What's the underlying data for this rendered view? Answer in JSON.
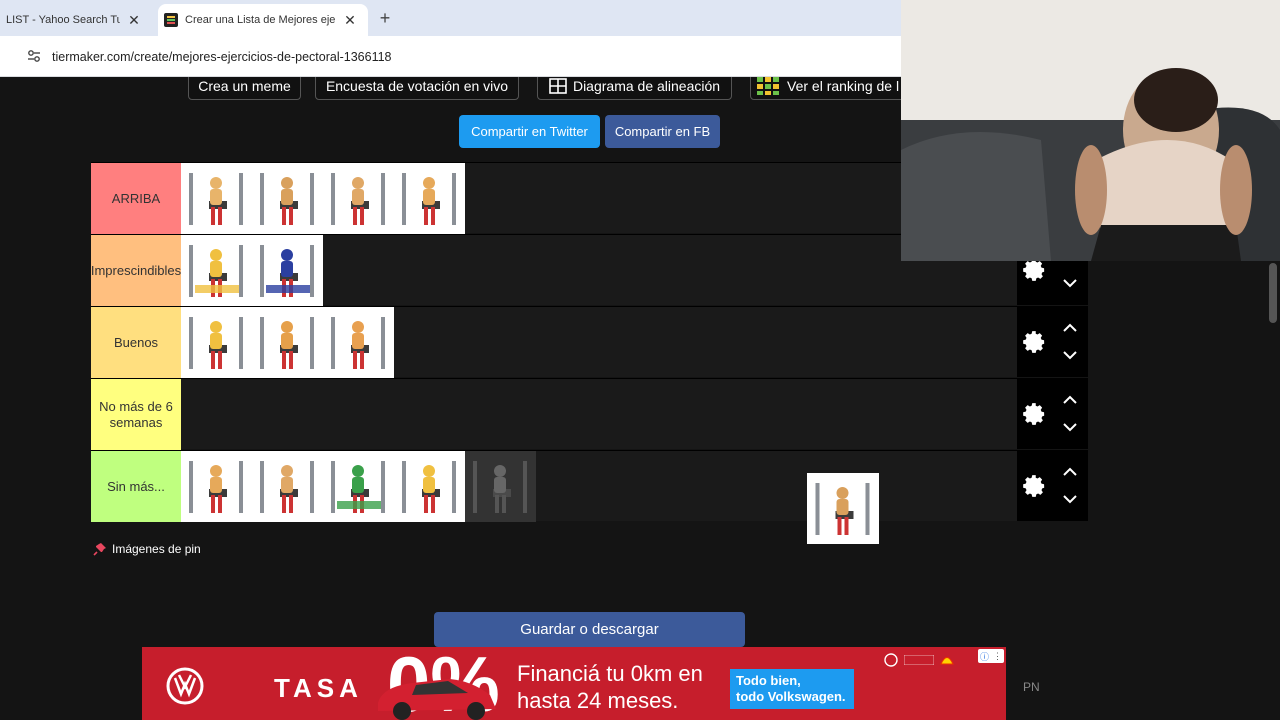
{
  "browser": {
    "tabs": [
      {
        "title": "LIST - Yahoo Search Tus re"
      },
      {
        "title": "Crear una Lista de Mejores ejerc"
      }
    ],
    "url": "tiermaker.com/create/mejores-ejercicios-de-pectoral-1366118"
  },
  "top_buttons": [
    "Crea un meme",
    "Encuesta de votación en vivo",
    "Diagrama de alineación",
    "Ver el ranking de l"
  ],
  "share": {
    "twitter": "Compartir en Twitter",
    "fb": "Compartir en FB",
    "twitter_color": "#1d9bf0",
    "fb_color": "#3c5a9a"
  },
  "tiers": [
    {
      "label": "ARRIBA",
      "color": "#ff7f7f",
      "item_count": 4
    },
    {
      "label": "Imprescindibles",
      "color": "#ffbf7f",
      "item_count": 2
    },
    {
      "label": "Buenos",
      "color": "#ffdf7f",
      "item_count": 3
    },
    {
      "label": "No más de 6 semanas",
      "color": "#ffff7f",
      "item_count": 0
    },
    {
      "label": "Sin más...",
      "color": "#bfff7f",
      "item_count": 5
    }
  ],
  "pin_label": "Imágenes de pin",
  "save_label": "Guardar o descargar",
  "ad": {
    "brand": "VW",
    "tasa": "TASA",
    "percent": "0%",
    "line1": "Financiá tu 0km en",
    "line2": "hasta 24 meses.",
    "badge_line1": "Todo bien,",
    "badge_line2": "todo Volkswagen."
  },
  "side_label": "PN"
}
